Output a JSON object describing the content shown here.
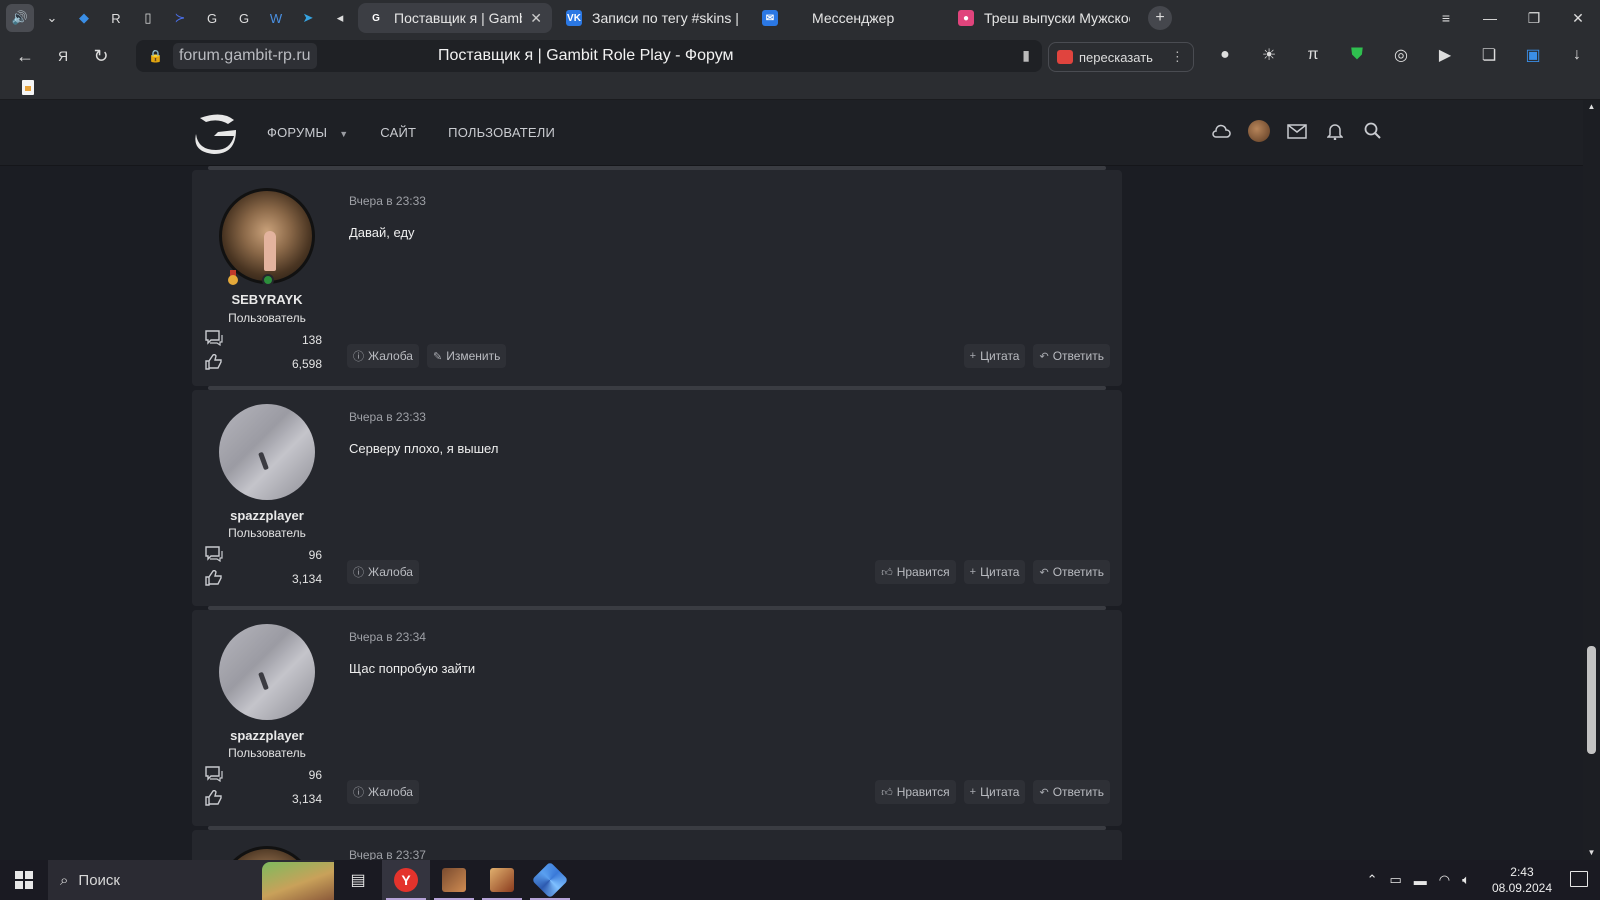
{
  "browser": {
    "tabs": [
      {
        "label": "Поставщик я | Gambit R",
        "favicon_color": "#3c3e44",
        "active": true
      },
      {
        "label": "Записи по тегу #skins | bl",
        "favicon_color": "#2b78e4",
        "active": false
      },
      {
        "label": "Мессенджер",
        "favicon_color": "#2b78e4",
        "active": false
      },
      {
        "label": "Треш выпуски Мужское Ж",
        "favicon_color": "#e0447c",
        "active": false
      }
    ],
    "address": {
      "domain": "forum.gambit-rp.ru",
      "page_title": "Поставщик я | Gambit Role Play - Форум"
    },
    "retell_label": "пересказать"
  },
  "forum": {
    "nav": {
      "forums": "ФОРУМЫ",
      "site": "САЙТ",
      "users": "ПОЛЬЗОВАТЕЛИ"
    },
    "posts": [
      {
        "username": "SEBYRAYK",
        "role": "Пользователь",
        "messages": "138",
        "reactions": "6,598",
        "date": "Вчера в 23:33",
        "text": "Давай, еду",
        "avatar": "cat",
        "actions_left": [
          "Жалоба",
          "Изменить"
        ],
        "actions_right": [
          "Цитата",
          "Ответить"
        ]
      },
      {
        "username": "spazzplayer",
        "role": "Пользователь",
        "messages": "96",
        "reactions": "3,134",
        "date": "Вчера в 23:33",
        "text": "Серверу плохо, я вышел",
        "avatar": "shirt",
        "actions_left": [
          "Жалоба"
        ],
        "actions_right": [
          "Нравится",
          "Цитата",
          "Ответить"
        ]
      },
      {
        "username": "spazzplayer",
        "role": "Пользователь",
        "messages": "96",
        "reactions": "3,134",
        "date": "Вчера в 23:34",
        "text": "Щас попробую зайти",
        "avatar": "shirt",
        "actions_left": [
          "Жалоба"
        ],
        "actions_right": [
          "Нравится",
          "Цитата",
          "Ответить"
        ]
      }
    ],
    "next_post_date": "Вчера в 23:37"
  },
  "taskbar": {
    "search_label": "Поиск",
    "time": "2:43",
    "date": "08.09.2024"
  },
  "colors": {
    "page_bg": "#1b1d23",
    "post_bg": "#25272d",
    "header_bg": "#1e2025",
    "yandex_red": "#e4332c"
  }
}
